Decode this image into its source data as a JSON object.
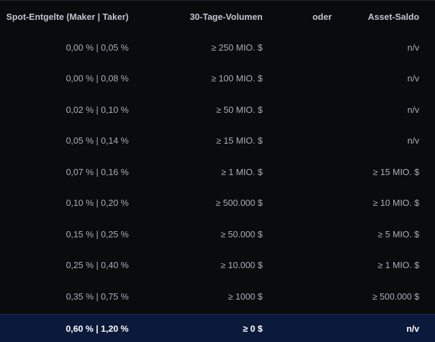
{
  "table": {
    "headers": {
      "fees": "Spot-Entgelte (Maker | Taker)",
      "volume": "30-Tage-Volumen",
      "or": "oder",
      "balance": "Asset-Saldo"
    },
    "rows": [
      {
        "fees": "0,00 % | 0,05 %",
        "volume": "≥ 250 MIO. $",
        "balance": "n/v"
      },
      {
        "fees": "0,00 % | 0,08 %",
        "volume": "≥ 100 MIO. $",
        "balance": "n/v"
      },
      {
        "fees": "0,02 % | 0,10 %",
        "volume": "≥ 50 MIO. $",
        "balance": "n/v"
      },
      {
        "fees": "0,05 % | 0,14 %",
        "volume": "≥ 15 MIO. $",
        "balance": "n/v"
      },
      {
        "fees": "0,07 % | 0,16 %",
        "volume": "≥ 1 MIO. $",
        "balance": "≥ 15 MIO. $"
      },
      {
        "fees": "0,10 % | 0,20 %",
        "volume": "≥ 500.000 $",
        "balance": "≥ 10 MIO. $"
      },
      {
        "fees": "0,15 % | 0,25 %",
        "volume": "≥ 50.000 $",
        "balance": "≥ 5 MIO. $"
      },
      {
        "fees": "0,25 % | 0,40 %",
        "volume": "≥ 10.000 $",
        "balance": "≥ 1 MIO. $"
      },
      {
        "fees": "0,35 % | 0,75 %",
        "volume": "≥ 1000 $",
        "balance": "≥ 500.000 $"
      },
      {
        "fees": "0,60 % | 1,20 %",
        "volume": "≥ 0 $",
        "balance": "n/v"
      }
    ],
    "highlighted_row": 9
  }
}
